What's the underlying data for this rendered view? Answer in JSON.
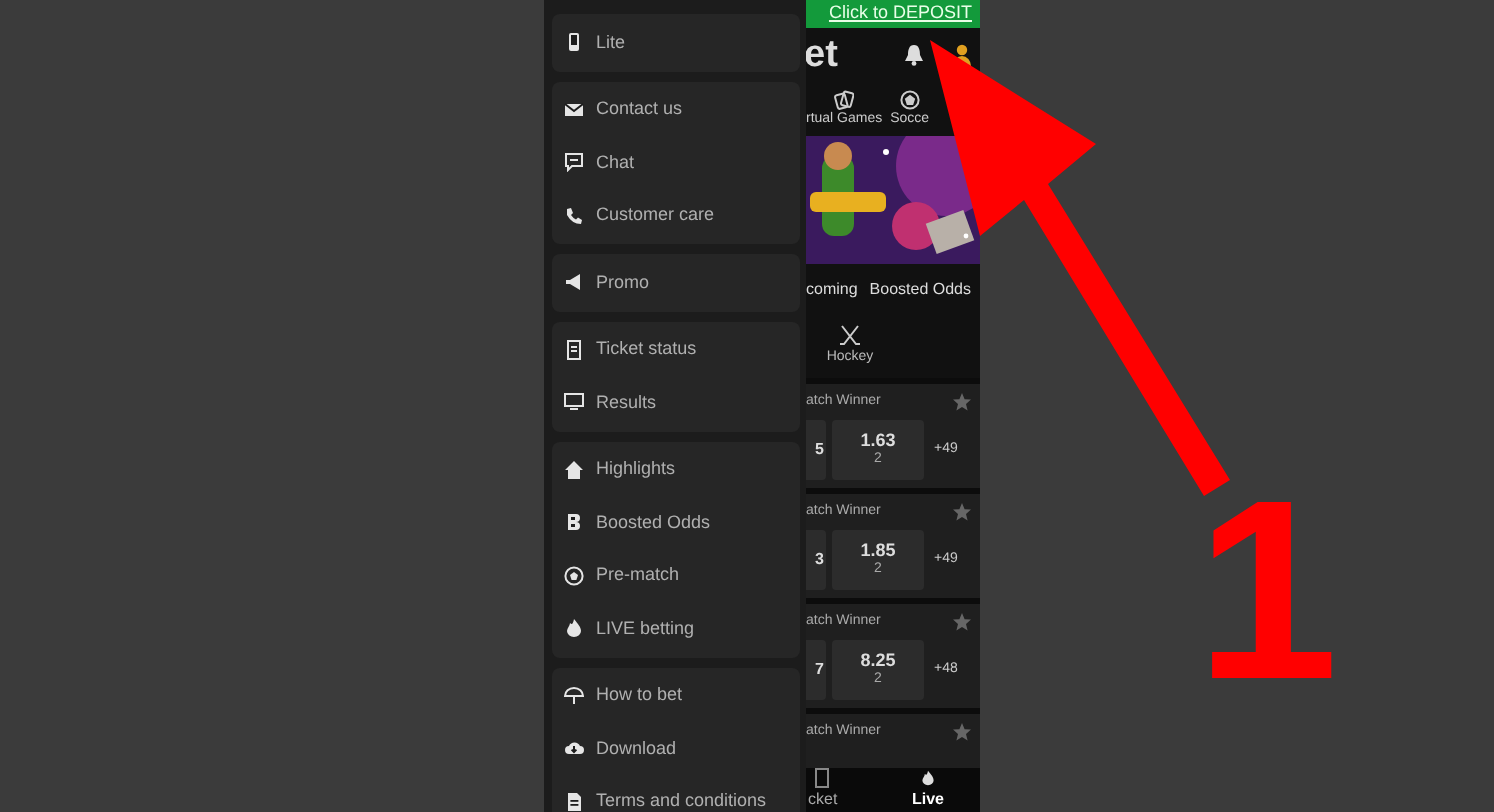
{
  "menu": {
    "groups": [
      {
        "items": [
          "Lite"
        ]
      },
      {
        "items": [
          "Contact us",
          "Chat",
          "Customer care"
        ]
      },
      {
        "items": [
          "Promo"
        ]
      },
      {
        "items": [
          "Ticket status",
          "Results"
        ]
      },
      {
        "items": [
          "Highlights",
          "Boosted Odds",
          "Pre-match",
          "LIVE betting"
        ]
      },
      {
        "items": [
          "How to bet",
          "Download",
          "Terms and conditions"
        ]
      }
    ]
  },
  "site": {
    "deposit_link": "Click to DEPOSIT",
    "logo": "et",
    "sports": [
      "rtual Games",
      "Socce"
    ],
    "banner": {
      "kind": "picture"
    },
    "tabs": [
      "coming",
      "Boosted Odds"
    ],
    "sport_filter": "Hockey",
    "matches": [
      {
        "market": "atch Winner",
        "odd_1": "5",
        "odd_2": "1.63",
        "odd_2_label": "2",
        "more": "+49"
      },
      {
        "market": "atch Winner",
        "odd_1": "3",
        "odd_2": "1.85",
        "odd_2_label": "2",
        "more": "+49"
      },
      {
        "market": "atch Winner",
        "odd_1": "7",
        "odd_2": "8.25",
        "odd_2_label": "2",
        "more": "+48"
      },
      {
        "market": "atch Winner"
      }
    ],
    "bottom_nav": [
      {
        "label": "cket",
        "selected": false
      },
      {
        "label": "Live",
        "selected": true
      }
    ]
  },
  "annotation": {
    "label": "1"
  }
}
